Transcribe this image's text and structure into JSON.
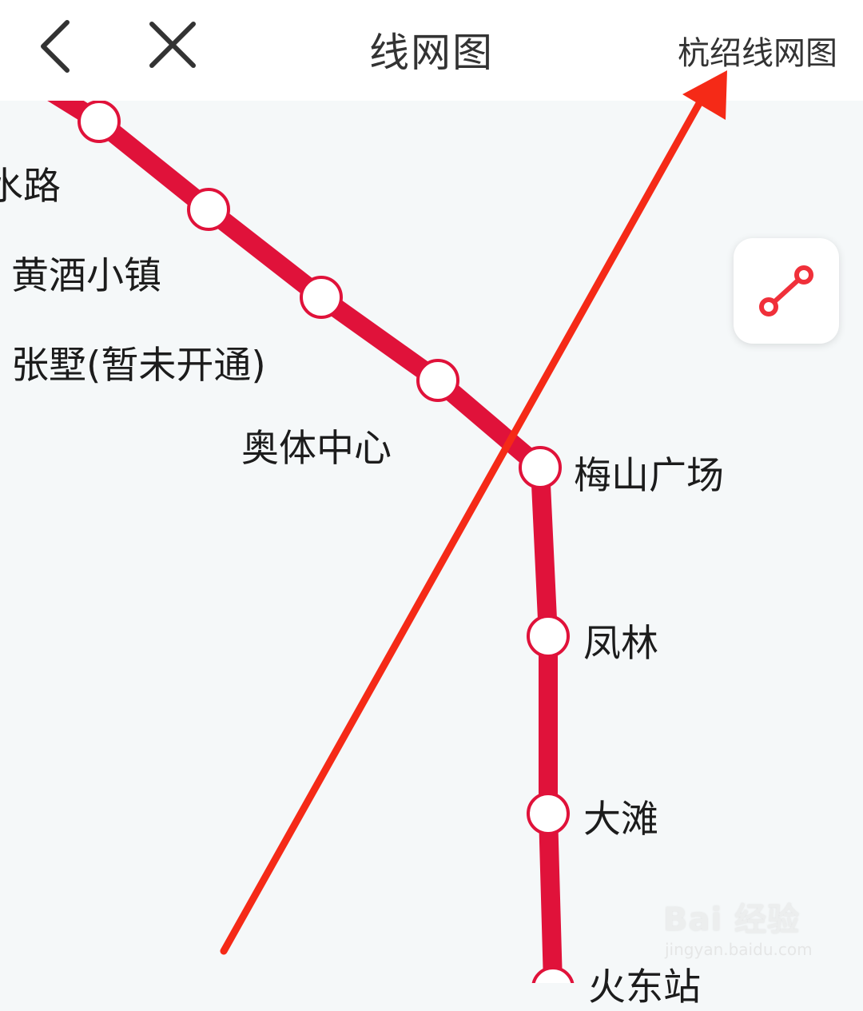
{
  "header": {
    "title": "线网图",
    "right_link": "杭绍线网图",
    "back_icon": "chevron-left-icon",
    "close_icon": "close-icon"
  },
  "line": {
    "color": "#e0123a",
    "stations": [
      {
        "name": ""
      },
      {
        "name": "水路"
      },
      {
        "name": "黄酒小镇"
      },
      {
        "name": "张墅(暂未开通)"
      },
      {
        "name": "奥体中心"
      },
      {
        "name": "梅山广场"
      },
      {
        "name": "凤林"
      },
      {
        "name": "大滩"
      },
      {
        "name": "火东站"
      }
    ]
  },
  "route_button": {
    "icon": "route-icon"
  },
  "annotation": {
    "color": "#f52a17"
  },
  "watermark": {
    "text": "Bai 经验",
    "sub": "jingyan.baidu.com"
  }
}
